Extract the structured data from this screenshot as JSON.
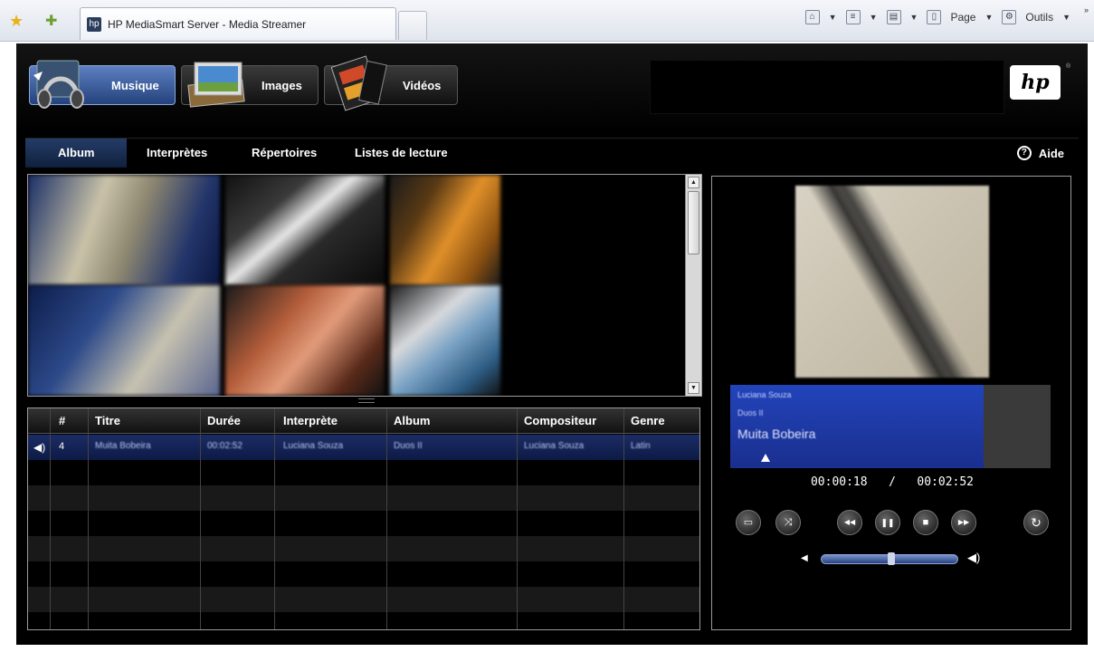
{
  "browser": {
    "tab_title": "HP MediaSmart Server - Media Streamer",
    "page_label": "Page",
    "tools_label": "Outils",
    "overflow": "»"
  },
  "media_tabs": [
    {
      "label": "Musique",
      "active": true
    },
    {
      "label": "Images",
      "active": false
    },
    {
      "label": "Vidéos",
      "active": false
    }
  ],
  "logo": {
    "text": "hp",
    "mark": "®"
  },
  "subnav": {
    "tabs": [
      "Album",
      "Interprètes",
      "Répertoires",
      "Listes de lecture"
    ],
    "active": "Album",
    "help_label": "Aide"
  },
  "table": {
    "headers": [
      "#",
      "Titre",
      "Durée",
      "Interprète",
      "Album",
      "Compositeur",
      "Genre"
    ],
    "rows": [
      {
        "num": "4",
        "title": "Muita Bobeira",
        "duration": "00:02:52",
        "artist": "Luciana Souza",
        "album": "Duos II",
        "composer": "Luciana Souza",
        "genre": "Latin",
        "playing": true
      }
    ]
  },
  "now_playing": {
    "artist": "Luciana Souza",
    "album": "Duos II",
    "title": "Muita Bobeira",
    "elapsed": "00:00:18",
    "separator": "/",
    "total": "00:02:52"
  },
  "player_progress": 0.1,
  "volume_level": 0.5,
  "colors": {
    "accent_blue": "#2244bb",
    "active_tab": "#3c5fa6",
    "background": "#000000"
  },
  "icons": {
    "fullscreen": "▭",
    "shuffle": "⤨",
    "rewind": "◀◀",
    "pause": "❚❚",
    "stop": "■",
    "forward": "▶▶",
    "repeat": "↻",
    "speaker": "◀)"
  }
}
